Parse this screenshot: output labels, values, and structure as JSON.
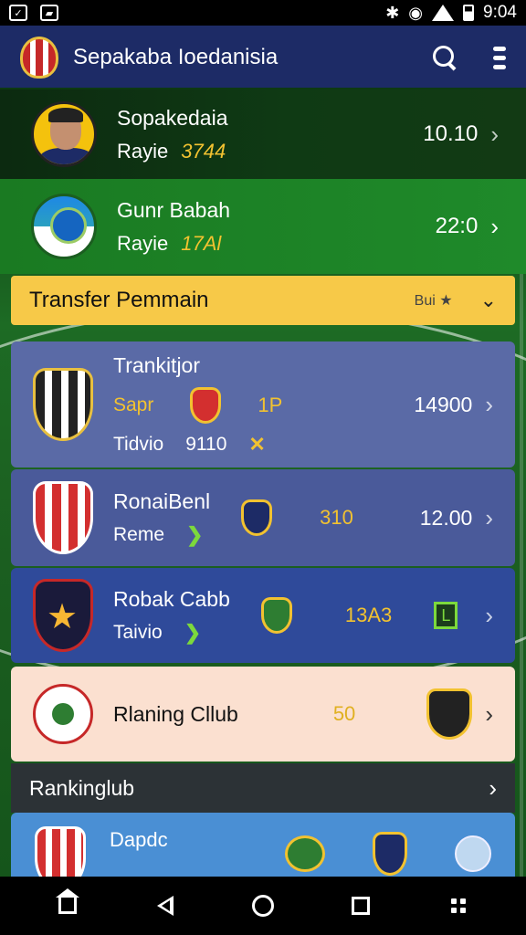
{
  "status_bar": {
    "time": "9:04"
  },
  "app_bar": {
    "title": "Sepakaba Ioedanisia"
  },
  "players": [
    {
      "name": "Sopakedaia",
      "sub_label": "Rayie",
      "sub_value": "3744",
      "value": "10.10"
    },
    {
      "name": "Gunr Babah",
      "sub_label": "Rayie",
      "sub_value": "17Al",
      "value": "22:0"
    }
  ],
  "transfer": {
    "title": "Transfer Pemmain",
    "tag": "Bui ★",
    "chevron": "⌄"
  },
  "cards": [
    {
      "name": "Trankitjor",
      "line1_label": "Sapr",
      "line1_num": "1P",
      "line2_label": "Tidvio",
      "line2_value": "9110",
      "value": "14900"
    },
    {
      "name": "RonaiBenl",
      "line2_label": "Reme",
      "num": "310",
      "value": "12.00"
    },
    {
      "name": "Robak Cabb",
      "line2_label": "Taivio",
      "num": "13A3",
      "tag": "L"
    },
    {
      "name": "Rlaning Cllub",
      "num": "50"
    }
  ],
  "ranking": {
    "title": "Rankinglub"
  },
  "bottom_card": {
    "name": "Dapdc"
  },
  "icons": {
    "chevron": "›",
    "cross": "✕",
    "arrow": "❯"
  }
}
